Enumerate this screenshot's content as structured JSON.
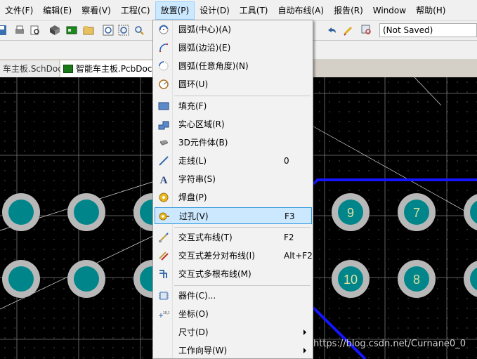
{
  "menubar": {
    "items": [
      "文件(F)",
      "编辑(E)",
      "察看(V)",
      "工程(C)",
      "放置(P)",
      "设计(D)",
      "工具(T)",
      "自动布线(A)",
      "报告(R)",
      "Window",
      "帮助(H)"
    ],
    "active_index": 4
  },
  "toolbar": {
    "save_state": "(Not Saved)"
  },
  "tabs": [
    {
      "label": "车主板.SchDoc *"
    },
    {
      "label": "智能车主板.PcbDoc"
    }
  ],
  "dropdown": {
    "items": [
      {
        "label": "圆弧(中心)(A)",
        "shortcut": "",
        "icon": "arc-center-icon"
      },
      {
        "label": "圆弧(边沿)(E)",
        "shortcut": "",
        "icon": "arc-edge-icon"
      },
      {
        "label": "圆弧(任意角度)(N)",
        "shortcut": "",
        "icon": "arc-any-angle-icon"
      },
      {
        "label": "圆环(U)",
        "shortcut": "",
        "icon": "full-circle-icon"
      },
      {
        "label": "填充(F)",
        "shortcut": "",
        "icon": "fill-icon"
      },
      {
        "label": "实心区域(R)",
        "shortcut": "",
        "icon": "solid-region-icon"
      },
      {
        "label": "3D元件体(B)",
        "shortcut": "",
        "icon": "3d-body-icon"
      },
      {
        "label": "走线(L)",
        "shortcut": "0",
        "icon": "line-icon"
      },
      {
        "label": "字符串(S)",
        "shortcut": "",
        "icon": "string-icon"
      },
      {
        "label": "焊盘(P)",
        "shortcut": "",
        "icon": "pad-icon"
      },
      {
        "label": "过孔(V)",
        "shortcut": "F3",
        "icon": "via-icon"
      },
      {
        "label": "交互式布线(T)",
        "shortcut": "F2",
        "icon": "interactive-routing-icon"
      },
      {
        "label": "交互式差分对布线(I)",
        "shortcut": "Alt+F2",
        "icon": "diff-pair-routing-icon"
      },
      {
        "label": "交互式多根布线(M)",
        "shortcut": "",
        "icon": "multi-routing-icon"
      },
      {
        "label": "器件(C)...",
        "shortcut": "",
        "icon": "component-icon"
      },
      {
        "label": "坐标(O)",
        "shortcut": "",
        "icon": "coordinate-icon"
      },
      {
        "label": "尺寸(D)",
        "shortcut": "",
        "icon": "",
        "submenu": true
      },
      {
        "label": "工作向导(W)",
        "shortcut": "",
        "icon": "",
        "submenu": true
      }
    ],
    "highlighted_index": 10
  },
  "canvas": {
    "pad_labels": [
      "9",
      "7",
      "10",
      "8"
    ],
    "colors": {
      "background": "#000000",
      "pad_ring": "#b8b8b8",
      "pad_fill": "#00868a",
      "route": "#1515ff"
    }
  },
  "watermark": "https://blog.csdn.net/Curnane0_0"
}
